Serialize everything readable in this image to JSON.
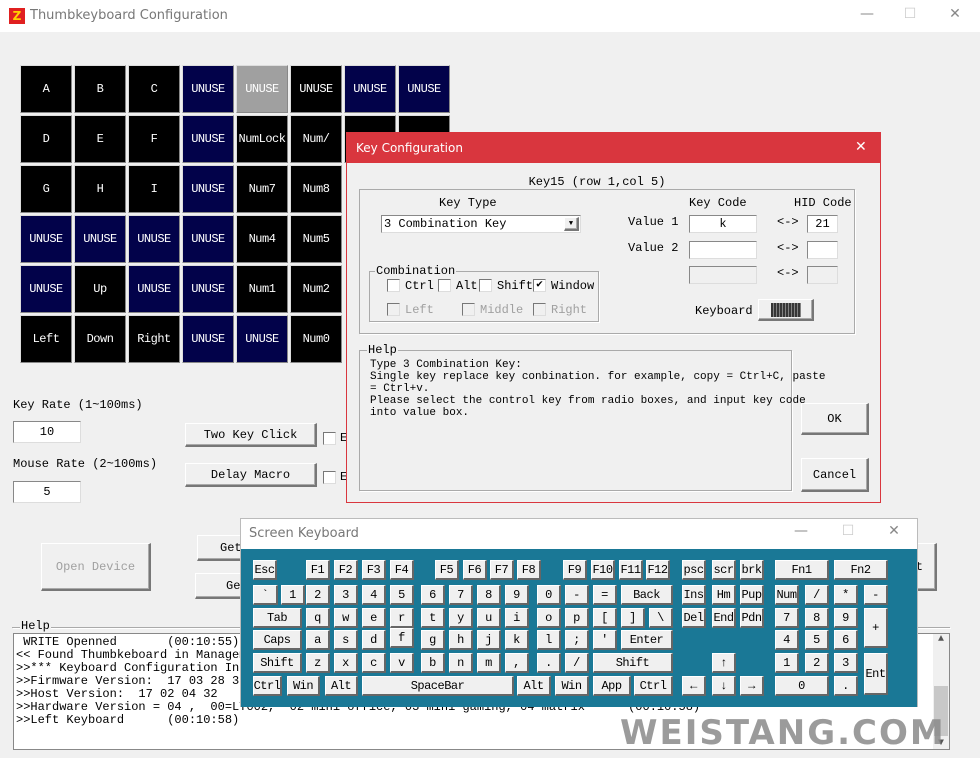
{
  "window": {
    "title": "Thumbkeyboard Configuration",
    "controls": [
      "—",
      "☐",
      "✕"
    ]
  },
  "colors": {
    "used": "#000000",
    "unused": "#02024a",
    "selected": "#a0a0a0",
    "dialog_accent": "#d9363e",
    "keyboard_bg": "#1a7896"
  },
  "grid": [
    [
      {
        "label": "A",
        "state": "used"
      },
      {
        "label": "B",
        "state": "used"
      },
      {
        "label": "C",
        "state": "used"
      },
      {
        "label": "UNUSE",
        "state": "unused"
      },
      {
        "label": "UNUSE",
        "state": "selected"
      },
      {
        "label": "UNUSE",
        "state": "used"
      },
      {
        "label": "UNUSE",
        "state": "unused"
      },
      {
        "label": "UNUSE",
        "state": "unused"
      }
    ],
    [
      {
        "label": "D",
        "state": "used"
      },
      {
        "label": "E",
        "state": "used"
      },
      {
        "label": "F",
        "state": "used"
      },
      {
        "label": "UNUSE",
        "state": "unused"
      },
      {
        "label": "NumLock",
        "state": "used"
      },
      {
        "label": "Num/",
        "state": "used"
      },
      {
        "label": "",
        "state": "used"
      },
      {
        "label": "",
        "state": "used"
      }
    ],
    [
      {
        "label": "G",
        "state": "used"
      },
      {
        "label": "H",
        "state": "used"
      },
      {
        "label": "I",
        "state": "used"
      },
      {
        "label": "UNUSE",
        "state": "unused"
      },
      {
        "label": "Num7",
        "state": "used"
      },
      {
        "label": "Num8",
        "state": "used"
      }
    ],
    [
      {
        "label": "UNUSE",
        "state": "unused"
      },
      {
        "label": "UNUSE",
        "state": "unused"
      },
      {
        "label": "UNUSE",
        "state": "unused"
      },
      {
        "label": "UNUSE",
        "state": "unused"
      },
      {
        "label": "Num4",
        "state": "used"
      },
      {
        "label": "Num5",
        "state": "used"
      }
    ],
    [
      {
        "label": "UNUSE",
        "state": "unused"
      },
      {
        "label": "Up",
        "state": "used"
      },
      {
        "label": "UNUSE",
        "state": "unused"
      },
      {
        "label": "UNUSE",
        "state": "unused"
      },
      {
        "label": "Num1",
        "state": "used"
      },
      {
        "label": "Num2",
        "state": "used"
      }
    ],
    [
      {
        "label": "Left",
        "state": "used"
      },
      {
        "label": "Down",
        "state": "used"
      },
      {
        "label": "Right",
        "state": "used"
      },
      {
        "label": "UNUSE",
        "state": "unused"
      },
      {
        "label": "UNUSE",
        "state": "unused"
      },
      {
        "label": "Num0",
        "state": "used"
      }
    ]
  ],
  "settings": {
    "key_rate_label": "Key Rate (1~100ms)",
    "key_rate_value": "10",
    "mouse_rate_label": "Mouse Rate (2~100ms)",
    "mouse_rate_value": "5",
    "two_key_click": "Two Key Click",
    "delay_macro": "Delay Macro",
    "check_fragment": "E",
    "open_device": "Open Device",
    "get_button_1": "Get",
    "get_button_2": "Ge",
    "right_button_fragment": "t"
  },
  "help": {
    "title": "Help",
    "lines": [
      " WRITE Openned       (00:10:55)",
      "<< Found Thumbkeboard in Managem",
      ">>*** Keyboard Configuration Inf",
      ">>Firmware Version:  17 03 28 30",
      ">>Host Version:  17 02 04 32",
      ">>Hardware Version = 04 ,  00=LY002,  02 mini office, 03 mini gaming, 04 matrix      (00:10:58)",
      ">>Left Keyboard      (00:10:58)"
    ]
  },
  "watermark": "WEISTANG.COM",
  "key_config": {
    "title": "Key Configuration",
    "key_id": "Key15 (row 1,col 5)",
    "key_type_label": "Key Type",
    "key_type_value": "3 Combination Key",
    "key_code_header": "Key Code",
    "hid_code_header": "HID Code",
    "value1_label": "Value 1",
    "value1_key": "k",
    "value1_hid": "21",
    "value2_label": "Value 2",
    "value2_key": "",
    "value2_hid": "",
    "arrow": "<->",
    "combination_label": "Combination",
    "modifiers": [
      {
        "label": "Ctrl",
        "checked": false
      },
      {
        "label": "Alt",
        "checked": false
      },
      {
        "label": "Shift",
        "checked": false
      },
      {
        "label": "Window",
        "checked": true
      }
    ],
    "mouse": [
      {
        "label": "Left",
        "checked": false
      },
      {
        "label": "Middle",
        "checked": false
      },
      {
        "label": "Right",
        "checked": false
      }
    ],
    "keyboard_label": "Keyboard",
    "help_title": "Help",
    "help_lines": [
      "Type 3 Combination Key:",
      "Single key replace key conbination. for example, copy = Ctrl+C, paste",
      "= Ctrl+v.",
      "Please select the control key from radio boxes, and input key code",
      "into value box."
    ],
    "ok": "OK",
    "cancel": "Cancel"
  },
  "screen_keyboard": {
    "title": "Screen Keyboard",
    "keys": [
      "Esc",
      "F1",
      "F2",
      "F3",
      "F4",
      "F5",
      "F6",
      "F7",
      "F8",
      "F9",
      "F10",
      "F11",
      "F12",
      "psc",
      "scr",
      "brk",
      "Fn1",
      "Fn2",
      "`",
      "1",
      "2",
      "3",
      "4",
      "5",
      "6",
      "7",
      "8",
      "9",
      "0",
      "-",
      "=",
      "Back",
      "Ins",
      "Hm",
      "Pup",
      "Num",
      "/",
      "*",
      "-",
      "Tab",
      "q",
      "w",
      "e",
      "r",
      "t",
      "y",
      "u",
      "i",
      "o",
      "p",
      "[",
      "]",
      "\\",
      "Del",
      "End",
      "Pdn",
      "7",
      "8",
      "9",
      "+",
      "Caps",
      "a",
      "s",
      "d",
      "f",
      "g",
      "h",
      "j",
      "k",
      "l",
      ";",
      "'",
      "Enter",
      "4",
      "5",
      "6",
      "Shift",
      "z",
      "x",
      "c",
      "v",
      "b",
      "n",
      "m",
      ",",
      ".",
      "/",
      "Shift",
      "↑",
      "1",
      "2",
      "3",
      "Ent",
      "Ctrl",
      "Win",
      "Alt",
      "SpaceBar",
      "Alt",
      "Win",
      "App",
      "Ctrl",
      "←",
      "↓",
      "→",
      "0",
      "."
    ]
  }
}
